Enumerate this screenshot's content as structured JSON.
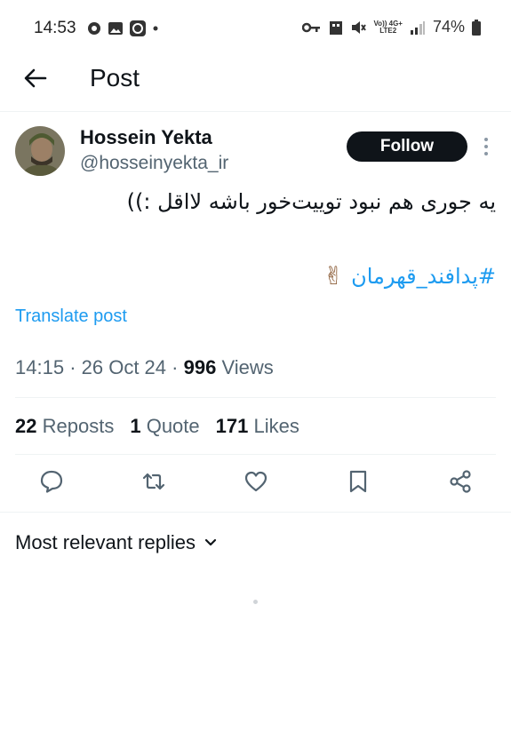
{
  "status_bar": {
    "time": "14:53",
    "network_top": "Vo)) 4G+",
    "network_bottom": "LTE2",
    "battery": "74%"
  },
  "header": {
    "title": "Post"
  },
  "author": {
    "name": "Hossein Yekta",
    "handle": "@hosseinyekta_ir",
    "follow_label": "Follow"
  },
  "post": {
    "text_line1": "یه جوری هم نبود توییت‌خور باشه لااقل :))",
    "hashtag": "#پدافند_قهرمان",
    "emoji": "✌",
    "translate_label": "Translate post"
  },
  "meta": {
    "time": "14:15",
    "date": "26 Oct 24",
    "views_count": "996",
    "views_label": "Views"
  },
  "stats": {
    "reposts_count": "22",
    "reposts_label": "Reposts",
    "quotes_count": "1",
    "quotes_label": "Quote",
    "likes_count": "171",
    "likes_label": "Likes"
  },
  "replies": {
    "sort_label": "Most relevant replies"
  }
}
